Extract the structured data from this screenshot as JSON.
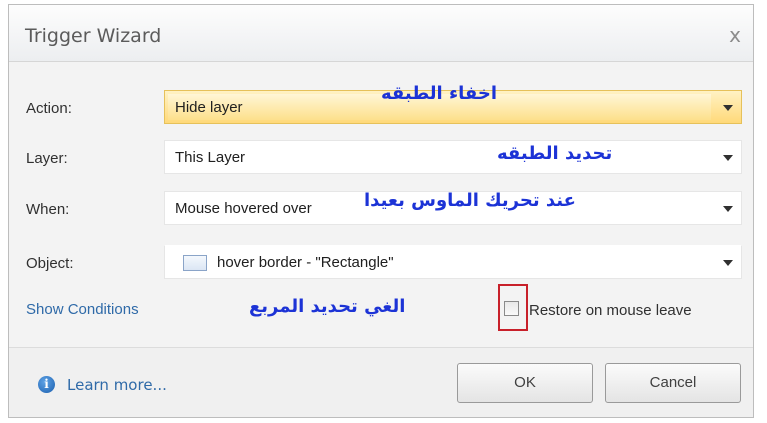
{
  "window": {
    "title": "Trigger Wizard",
    "close_glyph": "x"
  },
  "rows": [
    {
      "label": "Action:",
      "value": "Hide layer",
      "annotation": "اخفاء الطبقه"
    },
    {
      "label": "Layer:",
      "value": "This Layer",
      "annotation": "تحديد الطبقه"
    },
    {
      "label": "When:",
      "value": "Mouse hovered over",
      "annotation": "عند تحريك الماوس بعيدا"
    },
    {
      "label": "Object:",
      "value": "hover border - \"Rectangle\"",
      "icon": "rectangle-icon"
    }
  ],
  "show_conditions": "Show Conditions",
  "checkbox": {
    "label": "Restore on mouse leave",
    "checked": false,
    "annotation": "الغي تحديد المربع"
  },
  "footer": {
    "learn_more": "Learn more...",
    "info_icon_glyph": "i",
    "ok": "OK",
    "cancel": "Cancel"
  },
  "colors": {
    "annotation": "#1c33d6",
    "highlight_box": "#c8202a",
    "selected_field": "#ffd979"
  }
}
